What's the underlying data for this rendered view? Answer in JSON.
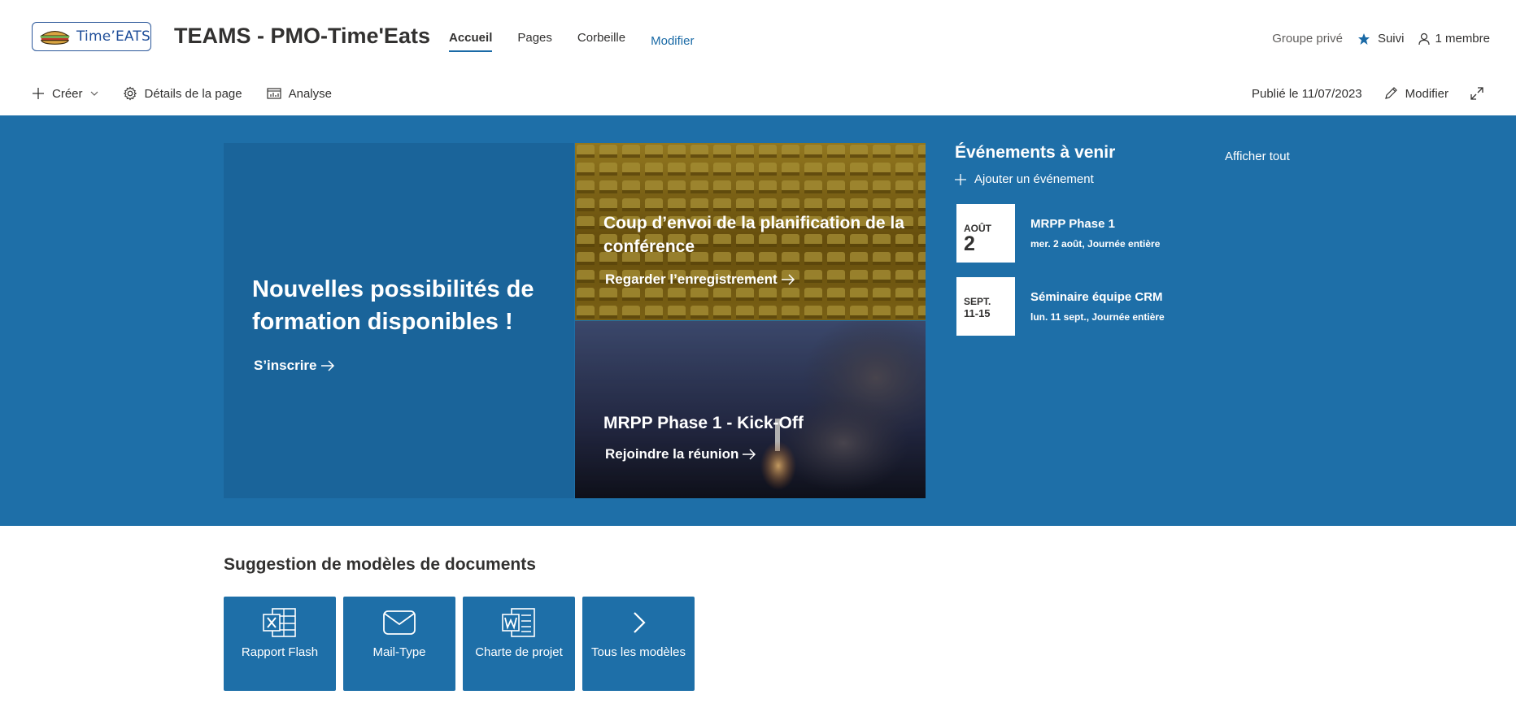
{
  "site": {
    "logo_text": "Time’EATS",
    "title": "TEAMS - PMO-Time'Eats"
  },
  "nav": {
    "items": [
      {
        "label": "Accueil",
        "active": true
      },
      {
        "label": "Pages"
      },
      {
        "label": "Corbeille"
      }
    ],
    "edit_label": "Modifier"
  },
  "header_right": {
    "group": "Groupe privé",
    "follow": "Suivi",
    "members": "1 membre"
  },
  "toolbar": {
    "create": "Créer",
    "page_details": "Détails de la page",
    "analytics": "Analyse",
    "published": "Publié le 11/07/2023",
    "edit": "Modifier"
  },
  "hero": {
    "main_title": "Nouvelles possibilités de formation disponibles !",
    "main_link": "S’inscrire",
    "tile_a_title": "Coup d’envoi de la planification de la conférence",
    "tile_a_link": "Regarder l’enregistrement",
    "tile_b_title": "MRPP Phase 1 - Kick-Off",
    "tile_b_link": "Rejoindre la réunion"
  },
  "events": {
    "title": "Événements à venir",
    "show_all": "Afficher tout",
    "add": "Ajouter un événement",
    "items": [
      {
        "month": "AOÛT",
        "day": "2",
        "name": "MRPP Phase 1",
        "sub": "mer. 2 août, Journée entière"
      },
      {
        "month": "SEPT.",
        "day": "11-15",
        "name": "Séminaire équipe CRM",
        "sub": "lun. 11 sept., Journée entière"
      }
    ]
  },
  "templates": {
    "title": "Suggestion de modèles de documents",
    "items": [
      {
        "label": "Rapport Flash",
        "icon": "excel-icon"
      },
      {
        "label": "Mail-Type",
        "icon": "mail-icon"
      },
      {
        "label": "Charte de projet",
        "icon": "word-icon"
      },
      {
        "label": "Tous les modèles",
        "icon": "chevron-right-icon"
      }
    ]
  },
  "colors": {
    "brand_blue": "#1e6fa8",
    "tile_dark": "#1a649a"
  }
}
